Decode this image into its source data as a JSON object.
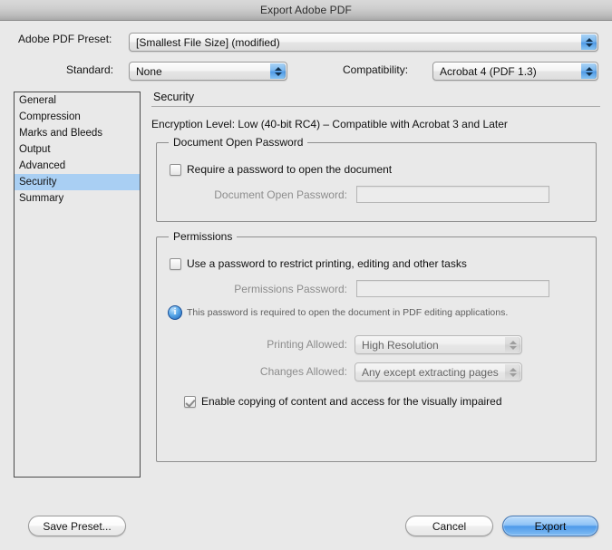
{
  "window": {
    "title": "Export Adobe PDF"
  },
  "top": {
    "preset_label": "Adobe PDF Preset:",
    "preset_value": "[Smallest File Size] (modified)",
    "standard_label": "Standard:",
    "standard_value": "None",
    "compatibility_label": "Compatibility:",
    "compatibility_value": "Acrobat 4 (PDF 1.3)"
  },
  "sidebar": {
    "items": [
      {
        "label": "General",
        "selected": false
      },
      {
        "label": "Compression",
        "selected": false
      },
      {
        "label": "Marks and Bleeds",
        "selected": false
      },
      {
        "label": "Output",
        "selected": false
      },
      {
        "label": "Advanced",
        "selected": false
      },
      {
        "label": "Security",
        "selected": true
      },
      {
        "label": "Summary",
        "selected": false
      }
    ]
  },
  "security": {
    "panel_title": "Security",
    "encryption_level": "Encryption Level: Low (40-bit RC4) – Compatible with Acrobat 3 and Later",
    "open_password_group": {
      "title": "Document Open Password",
      "require_checkbox_label": "Require a password to open the document",
      "require_checked": false,
      "password_label": "Document Open Password:",
      "password_value": ""
    },
    "permissions_group": {
      "title": "Permissions",
      "use_password_label": "Use a password to restrict printing, editing and other tasks",
      "use_password_checked": false,
      "password_label": "Permissions Password:",
      "password_value": "",
      "info_icon": "info-icon",
      "info_text": "This password is required to open the document in PDF editing applications.",
      "printing_label": "Printing Allowed:",
      "printing_value": "High Resolution",
      "changes_label": "Changes Allowed:",
      "changes_value": "Any except extracting pages",
      "enable_copying_label": "Enable copying of content and access for the visually impaired",
      "enable_copying_checked": true
    }
  },
  "footer": {
    "save_preset": "Save Preset...",
    "cancel": "Cancel",
    "export": "Export"
  },
  "colors": {
    "selection": "#a9cff3",
    "default_button": "#4e9ae9",
    "window_bg": "#e9e9e9"
  }
}
